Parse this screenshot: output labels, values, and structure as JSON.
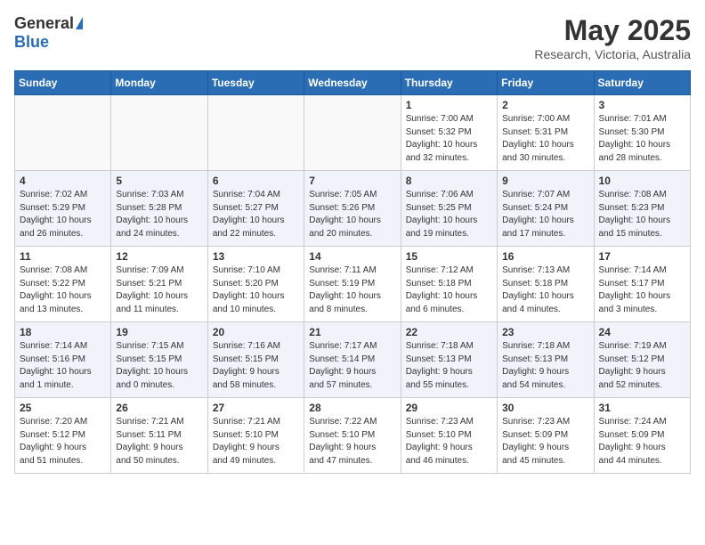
{
  "logo": {
    "general": "General",
    "blue": "Blue"
  },
  "title": "May 2025",
  "location": "Research, Victoria, Australia",
  "days_of_week": [
    "Sunday",
    "Monday",
    "Tuesday",
    "Wednesday",
    "Thursday",
    "Friday",
    "Saturday"
  ],
  "weeks": [
    [
      {
        "day": "",
        "info": ""
      },
      {
        "day": "",
        "info": ""
      },
      {
        "day": "",
        "info": ""
      },
      {
        "day": "",
        "info": ""
      },
      {
        "day": "1",
        "info": "Sunrise: 7:00 AM\nSunset: 5:32 PM\nDaylight: 10 hours\nand 32 minutes."
      },
      {
        "day": "2",
        "info": "Sunrise: 7:00 AM\nSunset: 5:31 PM\nDaylight: 10 hours\nand 30 minutes."
      },
      {
        "day": "3",
        "info": "Sunrise: 7:01 AM\nSunset: 5:30 PM\nDaylight: 10 hours\nand 28 minutes."
      }
    ],
    [
      {
        "day": "4",
        "info": "Sunrise: 7:02 AM\nSunset: 5:29 PM\nDaylight: 10 hours\nand 26 minutes."
      },
      {
        "day": "5",
        "info": "Sunrise: 7:03 AM\nSunset: 5:28 PM\nDaylight: 10 hours\nand 24 minutes."
      },
      {
        "day": "6",
        "info": "Sunrise: 7:04 AM\nSunset: 5:27 PM\nDaylight: 10 hours\nand 22 minutes."
      },
      {
        "day": "7",
        "info": "Sunrise: 7:05 AM\nSunset: 5:26 PM\nDaylight: 10 hours\nand 20 minutes."
      },
      {
        "day": "8",
        "info": "Sunrise: 7:06 AM\nSunset: 5:25 PM\nDaylight: 10 hours\nand 19 minutes."
      },
      {
        "day": "9",
        "info": "Sunrise: 7:07 AM\nSunset: 5:24 PM\nDaylight: 10 hours\nand 17 minutes."
      },
      {
        "day": "10",
        "info": "Sunrise: 7:08 AM\nSunset: 5:23 PM\nDaylight: 10 hours\nand 15 minutes."
      }
    ],
    [
      {
        "day": "11",
        "info": "Sunrise: 7:08 AM\nSunset: 5:22 PM\nDaylight: 10 hours\nand 13 minutes."
      },
      {
        "day": "12",
        "info": "Sunrise: 7:09 AM\nSunset: 5:21 PM\nDaylight: 10 hours\nand 11 minutes."
      },
      {
        "day": "13",
        "info": "Sunrise: 7:10 AM\nSunset: 5:20 PM\nDaylight: 10 hours\nand 10 minutes."
      },
      {
        "day": "14",
        "info": "Sunrise: 7:11 AM\nSunset: 5:19 PM\nDaylight: 10 hours\nand 8 minutes."
      },
      {
        "day": "15",
        "info": "Sunrise: 7:12 AM\nSunset: 5:18 PM\nDaylight: 10 hours\nand 6 minutes."
      },
      {
        "day": "16",
        "info": "Sunrise: 7:13 AM\nSunset: 5:18 PM\nDaylight: 10 hours\nand 4 minutes."
      },
      {
        "day": "17",
        "info": "Sunrise: 7:14 AM\nSunset: 5:17 PM\nDaylight: 10 hours\nand 3 minutes."
      }
    ],
    [
      {
        "day": "18",
        "info": "Sunrise: 7:14 AM\nSunset: 5:16 PM\nDaylight: 10 hours\nand 1 minute."
      },
      {
        "day": "19",
        "info": "Sunrise: 7:15 AM\nSunset: 5:15 PM\nDaylight: 10 hours\nand 0 minutes."
      },
      {
        "day": "20",
        "info": "Sunrise: 7:16 AM\nSunset: 5:15 PM\nDaylight: 9 hours\nand 58 minutes."
      },
      {
        "day": "21",
        "info": "Sunrise: 7:17 AM\nSunset: 5:14 PM\nDaylight: 9 hours\nand 57 minutes."
      },
      {
        "day": "22",
        "info": "Sunrise: 7:18 AM\nSunset: 5:13 PM\nDaylight: 9 hours\nand 55 minutes."
      },
      {
        "day": "23",
        "info": "Sunrise: 7:18 AM\nSunset: 5:13 PM\nDaylight: 9 hours\nand 54 minutes."
      },
      {
        "day": "24",
        "info": "Sunrise: 7:19 AM\nSunset: 5:12 PM\nDaylight: 9 hours\nand 52 minutes."
      }
    ],
    [
      {
        "day": "25",
        "info": "Sunrise: 7:20 AM\nSunset: 5:12 PM\nDaylight: 9 hours\nand 51 minutes."
      },
      {
        "day": "26",
        "info": "Sunrise: 7:21 AM\nSunset: 5:11 PM\nDaylight: 9 hours\nand 50 minutes."
      },
      {
        "day": "27",
        "info": "Sunrise: 7:21 AM\nSunset: 5:10 PM\nDaylight: 9 hours\nand 49 minutes."
      },
      {
        "day": "28",
        "info": "Sunrise: 7:22 AM\nSunset: 5:10 PM\nDaylight: 9 hours\nand 47 minutes."
      },
      {
        "day": "29",
        "info": "Sunrise: 7:23 AM\nSunset: 5:10 PM\nDaylight: 9 hours\nand 46 minutes."
      },
      {
        "day": "30",
        "info": "Sunrise: 7:23 AM\nSunset: 5:09 PM\nDaylight: 9 hours\nand 45 minutes."
      },
      {
        "day": "31",
        "info": "Sunrise: 7:24 AM\nSunset: 5:09 PM\nDaylight: 9 hours\nand 44 minutes."
      }
    ]
  ]
}
